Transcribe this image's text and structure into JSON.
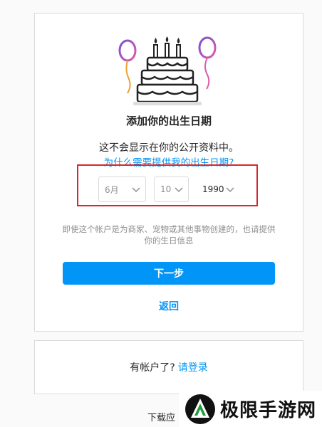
{
  "signup": {
    "title": "添加你的出生日期",
    "info": "这不会显示在你的公开资料中。",
    "why_link": "为什么需要提供我的出生日期?",
    "birthday": {
      "month": "6月",
      "day": "10",
      "year": "1990"
    },
    "note": "即使这个帐户是为商家、宠物或其他事物创建的，也请提供你的生日信息",
    "next_button": "下一步",
    "back_link": "返回"
  },
  "login_card": {
    "prompt": "有帐户了?",
    "login_link": "请登录"
  },
  "footer": {
    "download_text": "下载应"
  },
  "watermark": {
    "text": "极限手游网"
  },
  "colors": {
    "accent": "#0095f6",
    "highlight_box": "#d9262c",
    "balloon_purple": "#a46ad6",
    "balloon_pink": "#e05aa8",
    "watermark_green": "#1f9a3e"
  }
}
